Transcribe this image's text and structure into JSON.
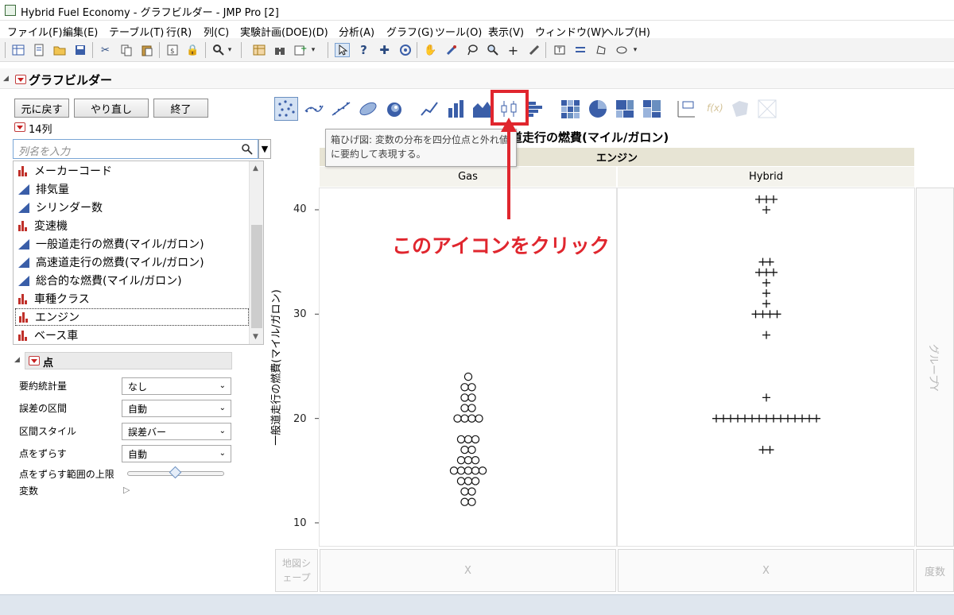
{
  "window": {
    "title": "Hybrid Fuel Economy - グラフビルダー - JMP Pro [2]"
  },
  "menu": [
    "ファイル(F)",
    "編集(E)",
    "テーブル(T)",
    "行(R)",
    "列(C)",
    "実験計画(DOE)(D)",
    "分析(A)",
    "グラフ(G)",
    "ツール(O)",
    "表示(V)",
    "ウィンドウ(W)",
    "ヘルプ(H)"
  ],
  "toolbar_icons": [
    "new-table-icon",
    "new-script-icon",
    "open-icon",
    "save-icon",
    "cut-icon",
    "copy-icon",
    "paste-icon",
    "journal-icon",
    "lock-icon",
    "search-icon",
    "data-table-icon",
    "binoculars-icon",
    "add-column-icon",
    "arrow-tool-icon",
    "help-tool-icon",
    "crosshair-icon",
    "grabber-icon",
    "hand-icon",
    "brush-icon",
    "lasso-icon",
    "magnifier-icon",
    "plus-icon",
    "line-tool-icon",
    "annotate-icon",
    "simple-shape-icon",
    "polygon-icon",
    "ellipse-icon"
  ],
  "builder": {
    "title": "グラフビルダー",
    "undo": "元に戻す",
    "redo": "やり直し",
    "done": "終了",
    "col_count": "14列",
    "search_placeholder": "列名を入力",
    "columns": [
      {
        "name": "メーカーコード",
        "type": "nominal"
      },
      {
        "name": "排気量",
        "type": "continuous"
      },
      {
        "name": "シリンダー数",
        "type": "continuous"
      },
      {
        "name": "変速機",
        "type": "nominal"
      },
      {
        "name": "一般道走行の燃費(マイル/ガロン)",
        "type": "continuous"
      },
      {
        "name": "高速道走行の燃費(マイル/ガロン)",
        "type": "continuous"
      },
      {
        "name": "総合的な燃費(マイル/ガロン)",
        "type": "continuous"
      },
      {
        "name": "車種クラス",
        "type": "nominal"
      },
      {
        "name": "エンジン",
        "type": "nominal",
        "selected": true
      },
      {
        "name": "ベース車",
        "type": "nominal"
      }
    ],
    "element_title": "点",
    "props": [
      {
        "label": "要約統計量",
        "value": "なし"
      },
      {
        "label": "誤差の区間",
        "value": "自動"
      },
      {
        "label": "区間スタイル",
        "value": "誤差バー"
      },
      {
        "label": "点をずらす",
        "value": "自動"
      }
    ],
    "jitter_limit_label": "点をずらす範囲の上限",
    "jitter_limit_fraction": 0.5,
    "variables_label": "変数"
  },
  "graph": {
    "tooltip": "箱ひげ図: 変数の分布を四分位点と外れ値に要約して表現する。",
    "title": "一般道走行の燃費(マイル/ガロン)",
    "group_label": "エンジン",
    "groups": [
      "Gas",
      "Hybrid"
    ],
    "y_label": "一般道走行の燃費(マイル/ガロン)",
    "y_ticks": [
      "10",
      "20",
      "30",
      "40"
    ],
    "annotation": "このアイコンをクリック",
    "group_y_zone": "グループY",
    "map_shape_zone": "地図シェープ",
    "x_zone": "X",
    "freq_zone": "度数",
    "highlight_color": "#e0262e"
  },
  "chart_data": {
    "type": "scatter",
    "title": "一般道走行の燃費(マイル/ガロン)",
    "ylabel": "一般道走行の燃費(マイル/ガロン)",
    "ylim": [
      8.5,
      43
    ],
    "series": [
      {
        "name": "Gas",
        "marker": "circle",
        "values": [
          12,
          12,
          13,
          13,
          14,
          14,
          14,
          15,
          15,
          15,
          15,
          15,
          16,
          16,
          16,
          17,
          17,
          18,
          18,
          18,
          20,
          20,
          20,
          20,
          21,
          21,
          22,
          22,
          23,
          23,
          24
        ]
      },
      {
        "name": "Hybrid",
        "marker": "plus",
        "values": [
          17,
          17,
          20,
          20,
          20,
          20,
          20,
          20,
          20,
          20,
          20,
          20,
          20,
          20,
          20,
          20,
          20,
          22,
          28,
          30,
          30,
          30,
          30,
          31,
          32,
          33,
          34,
          34,
          34,
          35,
          35,
          40,
          41,
          41,
          41
        ]
      }
    ]
  }
}
